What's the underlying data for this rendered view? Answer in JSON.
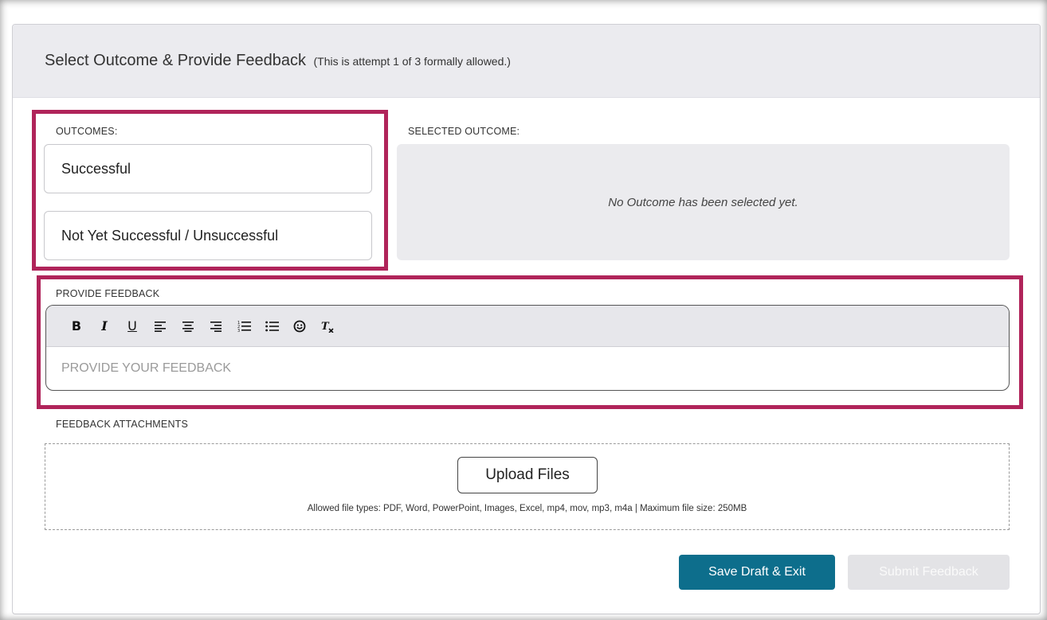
{
  "header": {
    "title": "Select Outcome & Provide Feedback",
    "attempt_note": "(This is attempt 1 of 3 formally allowed.)"
  },
  "outcomes": {
    "label": "OUTCOMES:",
    "options": [
      {
        "label": "Successful"
      },
      {
        "label": "Not Yet Successful / Unsuccessful"
      }
    ]
  },
  "selected_outcome": {
    "label": "SELECTED OUTCOME:",
    "empty_text": "No Outcome has been selected yet."
  },
  "feedback": {
    "label": "PROVIDE FEEDBACK",
    "placeholder": "PROVIDE YOUR FEEDBACK",
    "toolbar": {
      "bold": "B",
      "italic": "I",
      "underline": "U",
      "align_left": "align-left-icon",
      "align_center": "align-center-icon",
      "align_right": "align-right-icon",
      "ordered_list": "ordered-list-icon",
      "bullet_list": "bullet-list-icon",
      "emoji": "emoji-icon",
      "clear_format": "clear-format-icon"
    }
  },
  "attachments": {
    "label": "FEEDBACK ATTACHMENTS",
    "upload_label": "Upload Files",
    "allowed_text": "Allowed file types: PDF, Word, PowerPoint, Images, Excel, mp4, mov, mp3, m4a | Maximum file size: 250MB"
  },
  "actions": {
    "save_label": "Save Draft & Exit",
    "submit_label": "Submit Feedback"
  },
  "colors": {
    "highlight": "#b0245a",
    "primary": "#0d6e8c",
    "disabled": "#e3e3e6"
  }
}
